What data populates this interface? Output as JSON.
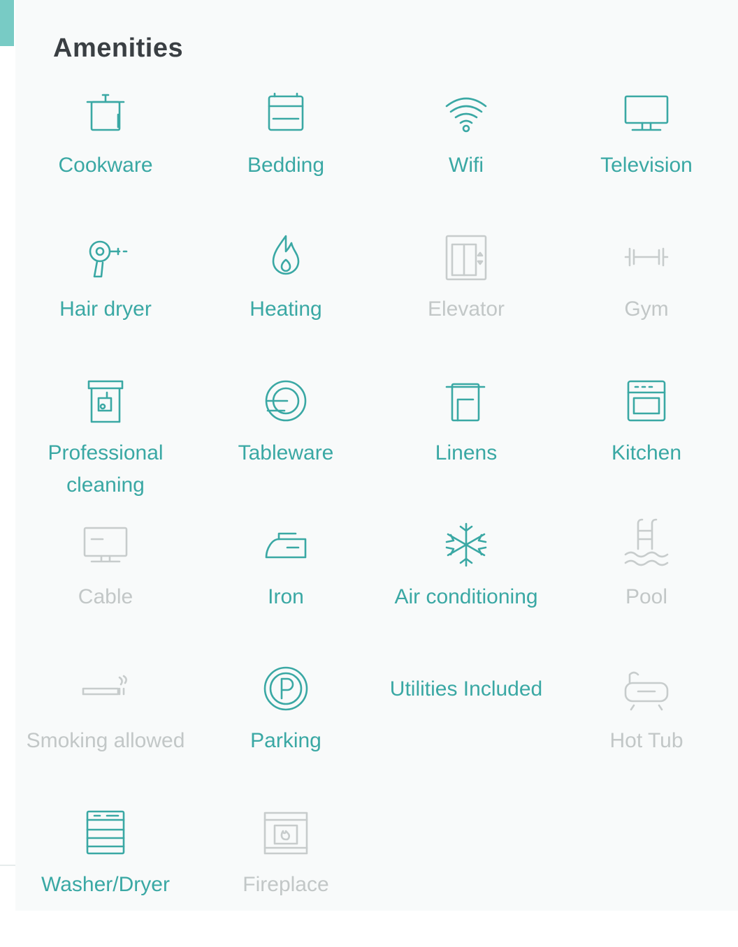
{
  "section": {
    "title": "Amenities"
  },
  "colors": {
    "active": "#3aa8a4",
    "inactive": "#c7cccc",
    "accent": "#78cbc5"
  },
  "amenities": [
    {
      "label": "Cookware",
      "icon": "cookware-icon",
      "available": true
    },
    {
      "label": "Bedding",
      "icon": "bedding-icon",
      "available": true
    },
    {
      "label": "Wifi",
      "icon": "wifi-icon",
      "available": true
    },
    {
      "label": "Television",
      "icon": "television-icon",
      "available": true
    },
    {
      "label": "Hair dryer",
      "icon": "hair-dryer-icon",
      "available": true
    },
    {
      "label": "Heating",
      "icon": "heating-icon",
      "available": true
    },
    {
      "label": "Elevator",
      "icon": "elevator-icon",
      "available": false
    },
    {
      "label": "Gym",
      "icon": "gym-icon",
      "available": false
    },
    {
      "label": "Professional cleaning",
      "icon": "professional-cleaning-icon",
      "available": true
    },
    {
      "label": "Tableware",
      "icon": "tableware-icon",
      "available": true
    },
    {
      "label": "Linens",
      "icon": "linens-icon",
      "available": true
    },
    {
      "label": "Kitchen",
      "icon": "kitchen-icon",
      "available": true
    },
    {
      "label": "Cable",
      "icon": "cable-icon",
      "available": false
    },
    {
      "label": "Iron",
      "icon": "iron-icon",
      "available": true
    },
    {
      "label": "Air conditioning",
      "icon": "air-conditioning-icon",
      "available": true
    },
    {
      "label": "Pool",
      "icon": "pool-icon",
      "available": false
    },
    {
      "label": "Smoking allowed",
      "icon": "smoking-icon",
      "available": false
    },
    {
      "label": "Parking",
      "icon": "parking-icon",
      "available": true
    },
    {
      "label": "Utilities Included",
      "icon": "",
      "available": true
    },
    {
      "label": "Hot Tub",
      "icon": "hot-tub-icon",
      "available": false
    },
    {
      "label": "Washer/Dryer",
      "icon": "washer-dryer-icon",
      "available": true
    },
    {
      "label": "Fireplace",
      "icon": "fireplace-icon",
      "available": false
    }
  ]
}
